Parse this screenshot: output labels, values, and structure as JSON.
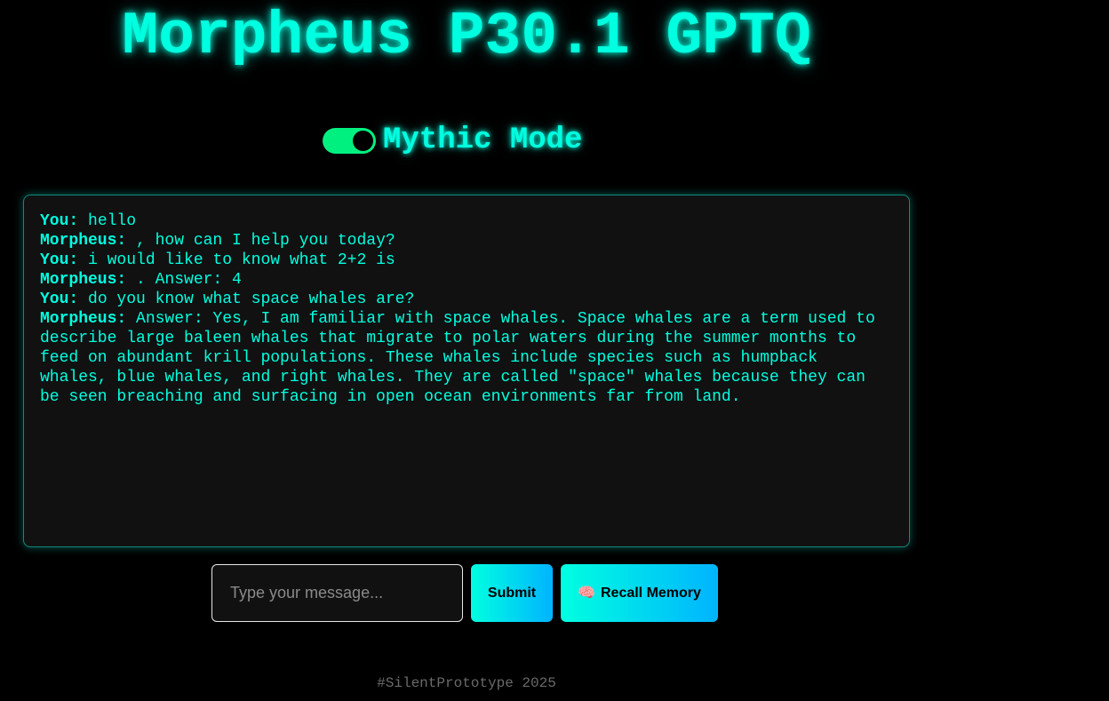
{
  "header": {
    "title": "Morpheus P30.1 GPTQ"
  },
  "mode_toggle": {
    "label": "Mythic Mode",
    "enabled": true,
    "on_color": "#00f080"
  },
  "chat": {
    "messages": [
      {
        "speaker": "You:",
        "text": " hello"
      },
      {
        "speaker": "Morpheus:",
        "text": " , how can I help you today?"
      },
      {
        "speaker": "You:",
        "text": " i would like to know what 2+2 is"
      },
      {
        "speaker": "Morpheus:",
        "text": " . Answer: 4"
      },
      {
        "speaker": "You:",
        "text": " do you know what space whales are?"
      },
      {
        "speaker": "Morpheus:",
        "text": " Answer: Yes, I am familiar with space whales. Space whales are a term used to describe large baleen whales that migrate to polar waters during the summer months to feed on abundant krill populations. These whales include species such as humpback whales, blue whales, and right whales. They are called \"space\" whales because they can be seen breaching and surfacing in open ocean environments far from land."
      }
    ]
  },
  "composer": {
    "input_value": "",
    "input_placeholder": "Type your message...",
    "submit_label": "Submit",
    "recall_label": "Recall Memory",
    "recall_icon": "brain-icon"
  },
  "footer": {
    "text": "#SilentPrototype 2025"
  },
  "colors": {
    "accent": "#00ffe0",
    "button_gradient_start": "#00ffe0",
    "button_gradient_end": "#00b4ff",
    "background": "#000000",
    "panel": "#111111"
  }
}
